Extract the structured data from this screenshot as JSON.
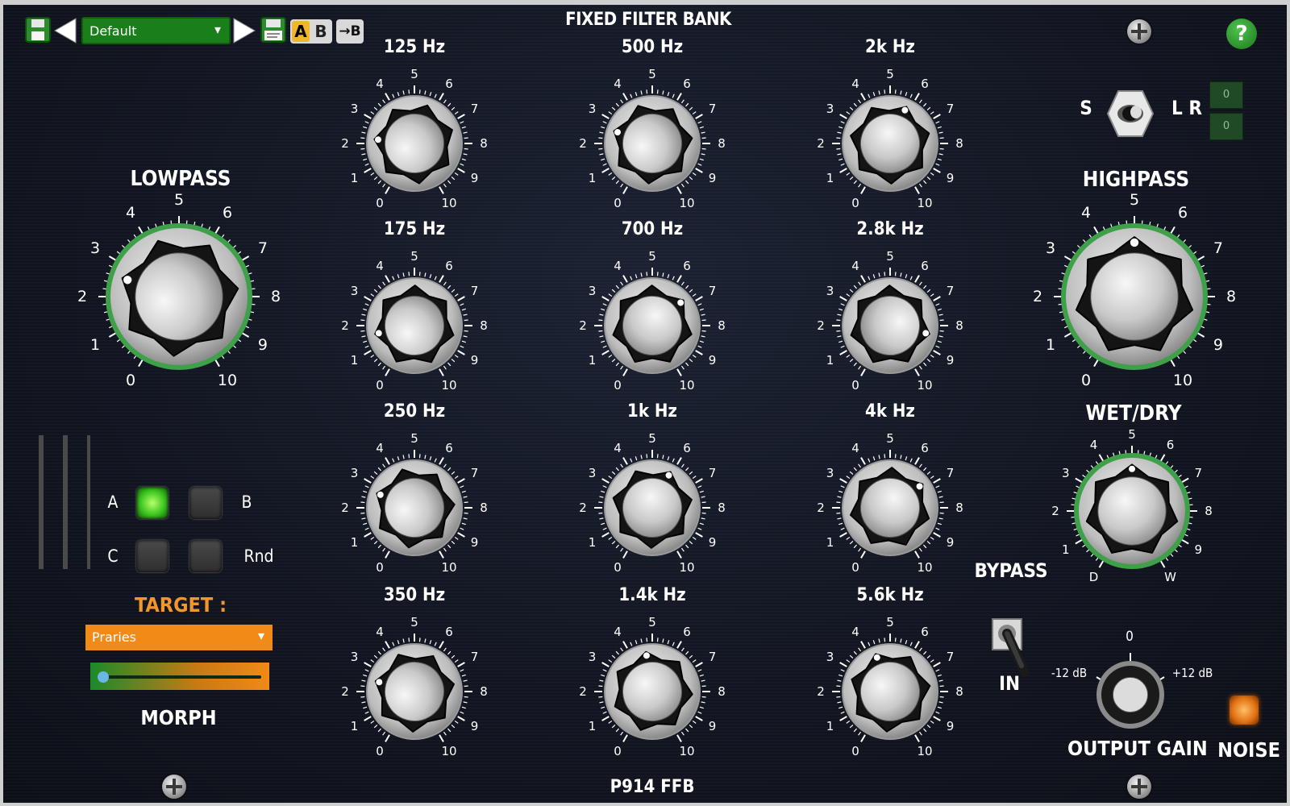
{
  "title": "FIXED FILTER BANK",
  "footer_model": "P914 FFB",
  "preset": {
    "name": "Default",
    "chevron": "▾"
  },
  "ab": {
    "a": "A",
    "b": "B"
  },
  "copy_to_b": "→B",
  "help": "?",
  "lowpass": {
    "label": "LOWPASS",
    "value": 2.6
  },
  "highpass": {
    "label": "HIGHPASS",
    "value": 5.0
  },
  "wetdry": {
    "label": "WET/DRY",
    "value": 5.0,
    "left": "D",
    "right": "W"
  },
  "bands": [
    {
      "label": "125 Hz",
      "value": 2.2
    },
    {
      "label": "500 Hz",
      "value": 2.6
    },
    {
      "label": "2k Hz",
      "value": 5.8
    },
    {
      "label": "175 Hz",
      "value": 1.6
    },
    {
      "label": "700 Hz",
      "value": 6.7
    },
    {
      "label": "2.8k Hz",
      "value": 8.4
    },
    {
      "label": "250 Hz",
      "value": 2.7
    },
    {
      "label": "1k Hz",
      "value": 5.9
    },
    {
      "label": "4k Hz",
      "value": 6.8
    },
    {
      "label": "350 Hz",
      "value": 2.5
    },
    {
      "label": "1.4k Hz",
      "value": 4.7
    },
    {
      "label": "5.6k Hz",
      "value": 4.3
    }
  ],
  "scale_labels": [
    "0",
    "1",
    "2",
    "3",
    "4",
    "5",
    "6",
    "7",
    "8",
    "9",
    "10"
  ],
  "stereo": {
    "s": "S",
    "lr": "L R",
    "values": [
      "0",
      "0"
    ]
  },
  "morph": {
    "buttons": [
      {
        "label": "A",
        "active": true
      },
      {
        "label": "B",
        "active": false
      },
      {
        "label": "C",
        "active": false
      },
      {
        "label": "Rnd",
        "active": false
      }
    ],
    "target_label": "TARGET :",
    "target_value": "Praries",
    "chevron": "▾",
    "slider_label": "MORPH",
    "slider_value": 0.02
  },
  "bypass": {
    "label": "BYPASS",
    "state": "IN"
  },
  "output_gain": {
    "label": "OUTPUT GAIN",
    "min_label": "-12 dB",
    "max_label": "+12 dB",
    "center_label": "0",
    "value": 0.5
  },
  "noise": {
    "label": "NOISE",
    "on": true
  },
  "colors": {
    "accent_green": "#3fa04a",
    "panel_dark": "#141927",
    "target_orange": "#f18a16",
    "preset_green": "#1a7f1a",
    "morph_active": "#5ee33a"
  }
}
